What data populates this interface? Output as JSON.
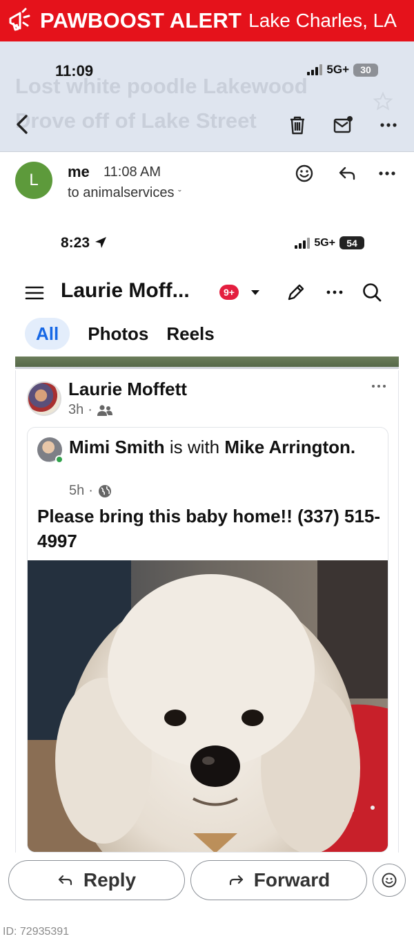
{
  "alert": {
    "title": "PAWBOOST ALERT",
    "location": "Lake Charles, LA"
  },
  "mail": {
    "status_time": "11:09",
    "network": "5G+",
    "battery": "30",
    "subject": "Lost white poodle Lakewood Drove off of Lake Street",
    "sender": {
      "avatar_letter": "L",
      "name": "me",
      "time": "11:08 AM",
      "recipient": "to animalservices"
    }
  },
  "screenshot": {
    "status_time": "8:23",
    "network": "5G+",
    "battery": "54",
    "page_name": "Laurie Moff...",
    "notif_count": "9+",
    "tabs": [
      {
        "label": "All",
        "active": true
      },
      {
        "label": "Photos",
        "active": false
      },
      {
        "label": "Reels",
        "active": false
      }
    ],
    "post": {
      "author": "Laurie Moffett",
      "age": "3h",
      "shared": {
        "author": "Mimi Smith",
        "with_text": "is with",
        "with_name": "Mike Arrington",
        "age": "5h",
        "text": "Please bring this baby home!! (337) 515-4997"
      }
    }
  },
  "actions": {
    "reply": "Reply",
    "forward": "Forward"
  },
  "listing_id": "ID: 72935391"
}
